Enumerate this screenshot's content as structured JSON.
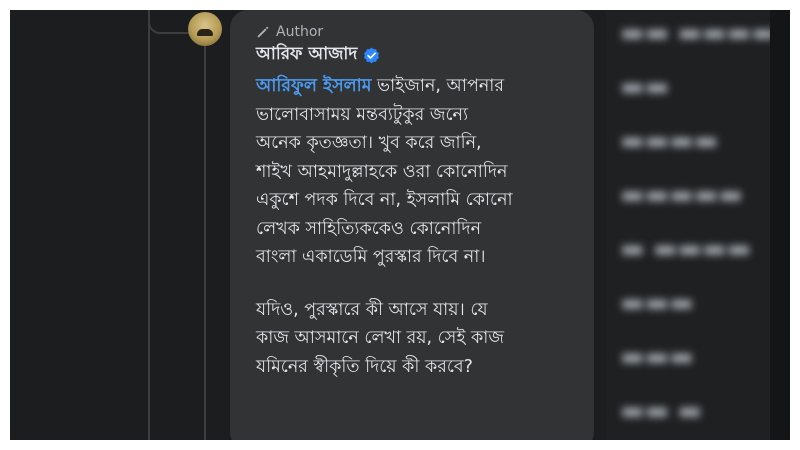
{
  "comment": {
    "badge_label": "Author",
    "author_name": "আরিফ আজাদ",
    "mention": "আরিফুল ইসলাম",
    "lines": [
      " ভাইজান, আপনার",
      "ভালোবাসাময় মন্তব্যটুকুর জন্যে",
      "অনেক কৃতজ্ঞতা। খুব করে জানি,",
      "শাইখ আহমাদুল্লাহকে ওরা কোনোদিন",
      "একুশে পদক দিবে না, ইসলামি কোনো",
      "লেখক সাহিত্যিককেও কোনোদিন",
      "বাংলা একাডেমি পুরস্কার দিবে না।"
    ],
    "lines2": [
      "যদিও, পুরস্কারে কী আসে যায়। যে",
      "কাজ আসমানে লেখা রয়, সেই কাজ",
      "যমিনের স্বীকৃতি দিয়ে কী করবে?"
    ]
  },
  "colors": {
    "background": "#1c1d1f",
    "bubble": "#313335",
    "text": "#e4e6eb",
    "mention": "#4b9bf2",
    "verified": "#2d88ff"
  },
  "icons": {
    "badge": "pencil-icon",
    "verified": "verified-check-icon"
  }
}
